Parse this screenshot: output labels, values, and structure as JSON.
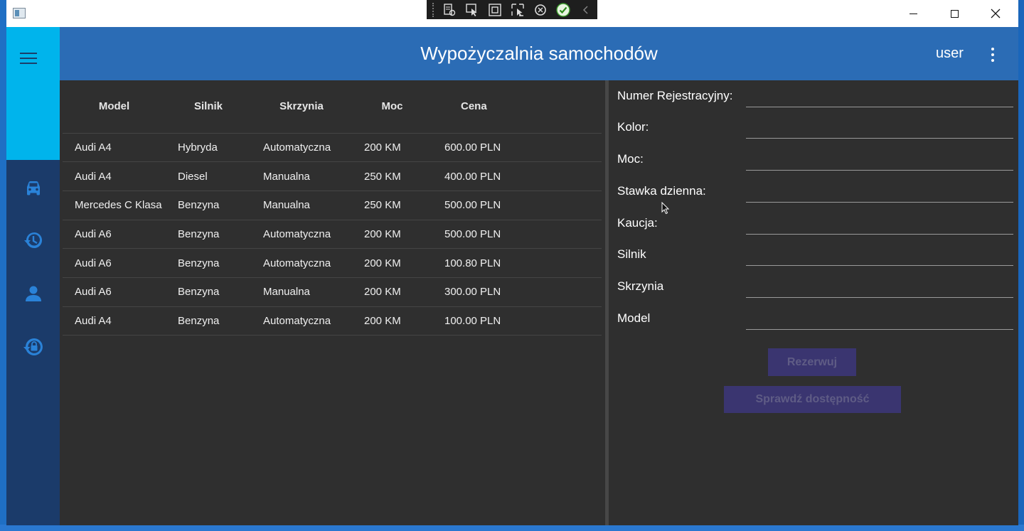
{
  "window": {
    "controls": {
      "minimize": "—",
      "maximize": "☐",
      "close": "✕"
    }
  },
  "debug_toolbar": {
    "icons": [
      "live-visual-tree-icon",
      "select-element-icon",
      "display-layout-adorners-icon",
      "track-focused-element-icon",
      "hot-reload-icon",
      "binding-failures-ok-icon",
      "collapse-chevron-icon"
    ]
  },
  "header": {
    "title": "Wypożyczalnia samochodów",
    "user": "user"
  },
  "colors": {
    "header": "#2b6cb5",
    "rail_top": "#00b4ec",
    "rail": "#1b3b6a",
    "rail_icon": "#2a82d8",
    "panel": "#2f2f2f",
    "button_disabled": "#3a3570"
  },
  "sidebar": {
    "items": [
      {
        "icon": "car-icon"
      },
      {
        "icon": "history-icon"
      },
      {
        "icon": "person-icon"
      },
      {
        "icon": "lock-reset-icon"
      }
    ]
  },
  "table": {
    "headers": [
      "Model",
      "Silnik",
      "Skrzynia",
      "Moc",
      "Cena"
    ],
    "rows": [
      [
        "Audi A4",
        "Hybryda",
        "Automatyczna",
        "200 KM",
        "600.00 PLN"
      ],
      [
        "Audi A4",
        "Diesel",
        "Manualna",
        "250 KM",
        "400.00 PLN"
      ],
      [
        "Mercedes C Klasa",
        "Benzyna",
        "Manualna",
        "250 KM",
        "500.00 PLN"
      ],
      [
        "Audi A6",
        "Benzyna",
        "Automatyczna",
        "200 KM",
        "500.00 PLN"
      ],
      [
        "Audi A6",
        "Benzyna",
        "Automatyczna",
        "200 KM",
        "100.80 PLN"
      ],
      [
        "Audi A6",
        "Benzyna",
        "Manualna",
        "200 KM",
        "300.00 PLN"
      ],
      [
        "Audi A4",
        "Benzyna",
        "Automatyczna",
        "200 KM",
        "100.00 PLN"
      ]
    ]
  },
  "form": {
    "fields": [
      {
        "label": "Numer Rejestracyjny:",
        "value": ""
      },
      {
        "label": "Kolor:",
        "value": ""
      },
      {
        "label": "Moc:",
        "value": ""
      },
      {
        "label": "Stawka dzienna:",
        "value": ""
      },
      {
        "label": "Kaucja:",
        "value": ""
      },
      {
        "label": "Silnik",
        "value": ""
      },
      {
        "label": "Skrzynia",
        "value": ""
      },
      {
        "label": "Model",
        "value": ""
      }
    ],
    "reserve_label": "Rezerwuj",
    "check_label": "Sprawdź dostępność"
  }
}
